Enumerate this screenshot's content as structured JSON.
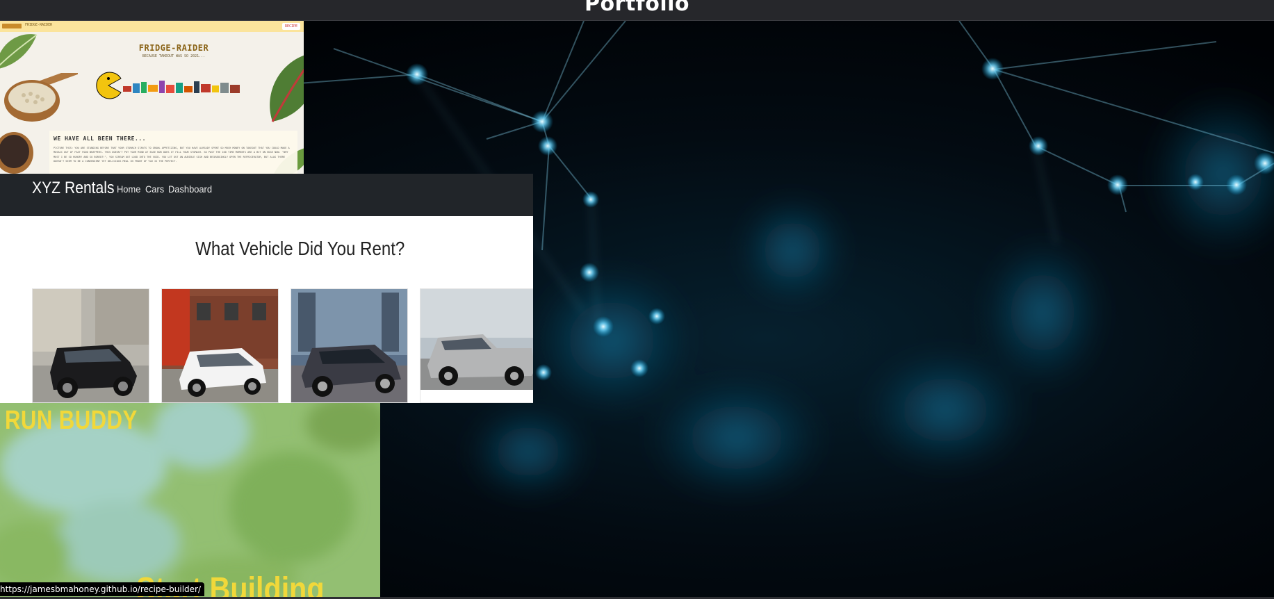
{
  "header": {
    "title": "Portfolio"
  },
  "projects": {
    "fridge_raider": {
      "nav_text": "FRIDGE-RAIDER",
      "nav_button": "RECIPE",
      "title": "FRIDGE-RAIDER",
      "subtitle": "BECAUSE TAKEOUT WAS SO 2021...",
      "panel_heading": "WE HAVE ALL BEEN THERE...",
      "panel_text": "PICTURE THIS: YOU ARE STANDING BEFORE THAT YOUR STOMACH STARTS TO GROWL APPETIZING, BUT YOU HAVE ALREADY SPENT SO MUCH MONEY ON TAKEOUT THAT YOU COULD MAKE A MOSAIC OUT OF FAST FOOD WRAPPERS. THIS DOESN'T PUT YOUR MIND AT EASE NOR DOES IT FILL YOUR STOMACH. SO PAST THE 100 TIME MOMENTS ARE A BIT ON EDGE NOW. \"WHY MUST I BE SO HUNGRY AND SO BORED?!\", YOU SCREAM OUT LOUD INTO THE VOID. YOU LET OUT AN AUDIBLE SIGH AND BEGRUDGINGLY OPEN THE REFRIGERATOR, BUT ALAS THERE DOESN'T SEEM TO BE A CONVENIENT YET DELICIOUS MEAL IN FRONT OF YOU IS THE PERFECT."
    },
    "xyz_rentals": {
      "brand": "XYZ Rentals",
      "nav": [
        "Home",
        "Cars",
        "Dashboard"
      ],
      "heading": "What Vehicle Did You Rent?"
    },
    "run_buddy": {
      "title": "RUN BUDDY",
      "cta": "Start Building"
    }
  },
  "status_bar": {
    "url": "https://jamesbmahoney.github.io/recipe-builder/"
  },
  "colors": {
    "header_bg": "#26272b",
    "xyz_nav_bg": "#212529",
    "run_buddy_accent": "#f1d83a",
    "network_glow": "#3fc6f5"
  }
}
